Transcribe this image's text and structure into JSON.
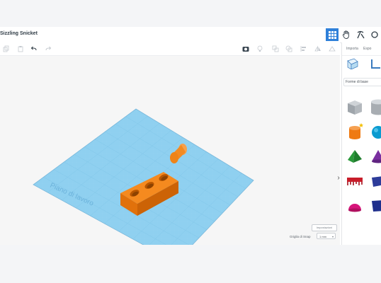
{
  "app": {
    "title": "Sizzling Snicket"
  },
  "view_buttons": [
    {
      "icon": "grid-view-icon",
      "active": true
    },
    {
      "icon": "hand-tool-icon",
      "active": false
    },
    {
      "icon": "pickaxe-icon",
      "active": false
    },
    {
      "icon": "user-icon",
      "active": false
    }
  ],
  "toolbar": {
    "items": [
      "copy-icon",
      "paste-icon",
      "undo-icon",
      "redo-icon",
      "camera-icon",
      "light-bulb-icon",
      "group-icon",
      "ungroup-icon",
      "align-icon",
      "mirror-icon",
      "flip-icon",
      "hide-icon"
    ]
  },
  "workplane": {
    "label": "Piano di lavoro"
  },
  "bottom": {
    "impostazioni_label": "Impostazioni",
    "snap_label": "Griglia di Snap",
    "snap_value": "1 mm"
  },
  "panel": {
    "tabs": [
      "Importa",
      "Espo"
    ],
    "category": "Forme di base",
    "shapes": [
      "box-shape-icon",
      "cylinder-gray-shape-icon",
      "cylinder-orange-shape-icon",
      "sphere-shape-icon",
      "pyramid-shape-icon",
      "cone-shape-icon",
      "text-shape-icon",
      "roof-shape-icon",
      "half-sphere-shape-icon",
      "wedge-shape-icon"
    ]
  },
  "colors": {
    "accent": "#2f80d9",
    "object": "#f07c16",
    "workplane": "#7fc7ec"
  }
}
